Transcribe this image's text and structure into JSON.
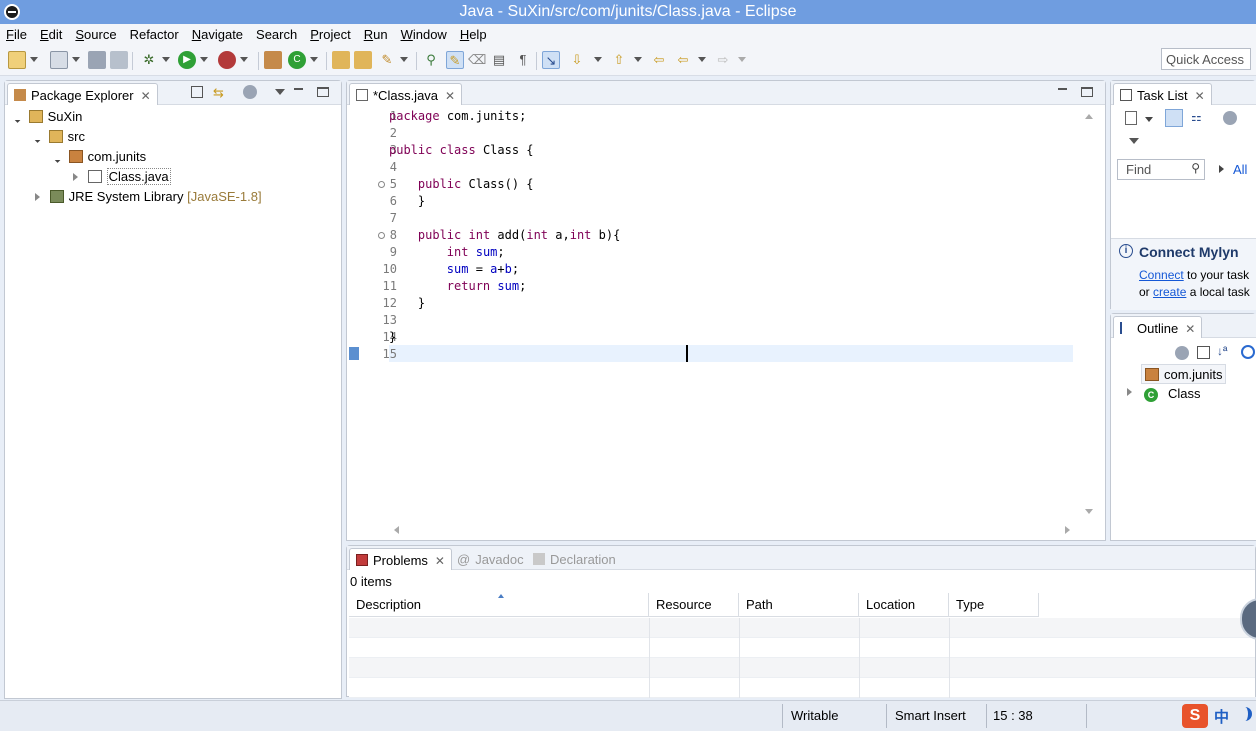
{
  "window": {
    "title": "Java - SuXin/src/com/junits/Class.java - Eclipse"
  },
  "menu": [
    {
      "label": "File",
      "mnemonic": "F",
      "rest": "ile"
    },
    {
      "label": "Edit",
      "mnemonic": "E",
      "rest": "dit"
    },
    {
      "label": "Source",
      "mnemonic": "S",
      "rest": "ource"
    },
    {
      "label": "Refactor",
      "mnemonic": "",
      "rest": "Refactor"
    },
    {
      "label": "Navigate",
      "mnemonic": "N",
      "rest": "avigate"
    },
    {
      "label": "Search",
      "mnemonic": "",
      "rest": "Search"
    },
    {
      "label": "Project",
      "mnemonic": "P",
      "rest": "roject"
    },
    {
      "label": "Run",
      "mnemonic": "R",
      "rest": "un"
    },
    {
      "label": "Window",
      "mnemonic": "W",
      "rest": "indow"
    },
    {
      "label": "Help",
      "mnemonic": "H",
      "rest": "elp"
    }
  ],
  "quick_access": {
    "placeholder": "Quick Access"
  },
  "package_explorer": {
    "tab_label": "Package Explorer",
    "tree": {
      "project": "SuXin",
      "src": "src",
      "package": "com.junits",
      "file": "Class.java",
      "library": "JRE System Library",
      "library_version": "[JavaSE-1.8]"
    }
  },
  "editor": {
    "tab_label": "*Class.java",
    "line_numbers": [
      "1",
      "2",
      "3",
      "4",
      "5",
      "6",
      "7",
      "8",
      "9",
      "10",
      "11",
      "12",
      "13",
      "14",
      "15"
    ],
    "lines": [
      "package com.junits;",
      "",
      "public class Class {",
      "",
      "    public Class() {",
      "    }",
      "",
      "    public int add(int a,int b){",
      "        int sum;",
      "        sum = a+b;",
      "        return sum;",
      "    }",
      "",
      "}",
      ""
    ]
  },
  "task_list": {
    "tab_label": "Task List",
    "find_placeholder": "Find",
    "all_label": "All",
    "mylyn_title": "Connect Mylyn",
    "mylyn_connect": "Connect",
    "mylyn_text1": " to your task",
    "mylyn_or": "or ",
    "mylyn_create": "create",
    "mylyn_text2": " a local task"
  },
  "outline": {
    "tab_label": "Outline",
    "items": [
      "com.junits",
      "Class"
    ]
  },
  "problems": {
    "tabs": [
      "Problems",
      "Javadoc",
      "Declaration"
    ],
    "count": "0 items",
    "columns": [
      "Description",
      "Resource",
      "Path",
      "Location",
      "Type"
    ]
  },
  "status": {
    "writable": "Writable",
    "insert_mode": "Smart Insert",
    "position": "15 : 38",
    "ime": "中"
  },
  "colors": {
    "title_bar": "#6f9de0",
    "keyword": "#7f0055",
    "field": "#0000c0",
    "library_version": "#9a7b3a",
    "link": "#1558d6"
  }
}
